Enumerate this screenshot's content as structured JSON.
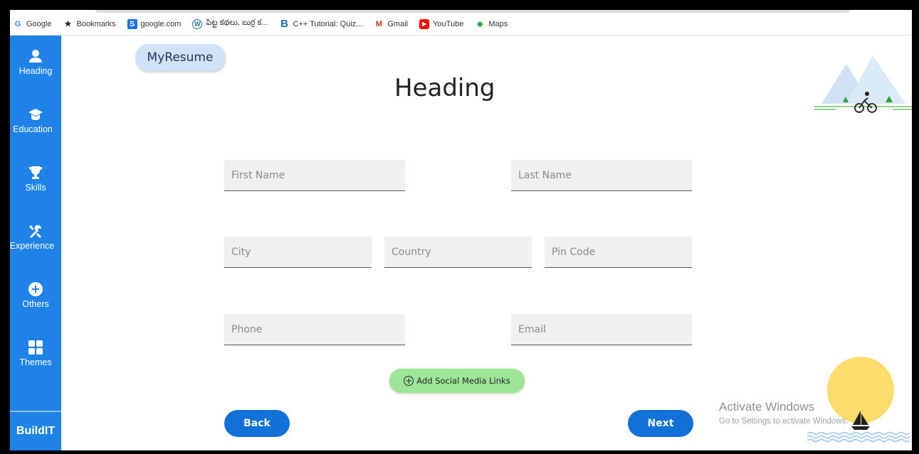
{
  "bookmarks": [
    {
      "label": "Google",
      "icon": "google-icon",
      "glyph": "G",
      "color": "#4285f4"
    },
    {
      "label": "Bookmarks",
      "icon": "star-icon",
      "glyph": "★",
      "color": "#222222"
    },
    {
      "label": "google.com",
      "icon": "site-icon",
      "glyph": "S",
      "color": "#1a73e8"
    },
    {
      "label": "పిట్ట కథలు, బుర్ర క...",
      "icon": "wordpress-icon",
      "glyph": "W",
      "color": "#21759b"
    },
    {
      "label": "C++ Tutorial: Quiz...",
      "icon": "b-icon",
      "glyph": "B",
      "color": "#1e6bb8"
    },
    {
      "label": "Gmail",
      "icon": "gmail-icon",
      "glyph": "M",
      "color": "#d93025"
    },
    {
      "label": "YouTube",
      "icon": "youtube-icon",
      "glyph": "▶",
      "color": "#ff0000"
    },
    {
      "label": "Maps",
      "icon": "maps-icon",
      "glyph": "◆",
      "color": "#34a853"
    }
  ],
  "sidebar": {
    "items": [
      {
        "label": "Heading",
        "icon": "person-icon"
      },
      {
        "label": "Education",
        "icon": "graduation-cap-icon"
      },
      {
        "label": "Skills",
        "icon": "trophy-icon"
      },
      {
        "label": "Experience",
        "icon": "tools-icon"
      },
      {
        "label": "Others",
        "icon": "plus-circle-icon"
      },
      {
        "label": "Themes",
        "icon": "grid-icon"
      }
    ],
    "brand": "BuildIT"
  },
  "header": {
    "logo": "MyResume",
    "title": "Heading"
  },
  "form": {
    "first_name": {
      "placeholder": "First Name",
      "value": ""
    },
    "last_name": {
      "placeholder": "Last Name",
      "value": ""
    },
    "city": {
      "placeholder": "City",
      "value": ""
    },
    "country": {
      "placeholder": "Country",
      "value": ""
    },
    "pin_code": {
      "placeholder": "Pin Code",
      "value": ""
    },
    "phone": {
      "placeholder": "Phone",
      "value": ""
    },
    "email": {
      "placeholder": "Email",
      "value": ""
    }
  },
  "actions": {
    "social": "Add Social Media Links",
    "back": "Back",
    "next": "Next"
  },
  "watermark": {
    "line1": "Activate Windows",
    "line2": "Go to Settings to activate Windows."
  },
  "colors": {
    "sidebar": "#1e82e6",
    "button": "#1271d8",
    "social": "#9fe597",
    "sun": "#fedd6c"
  }
}
